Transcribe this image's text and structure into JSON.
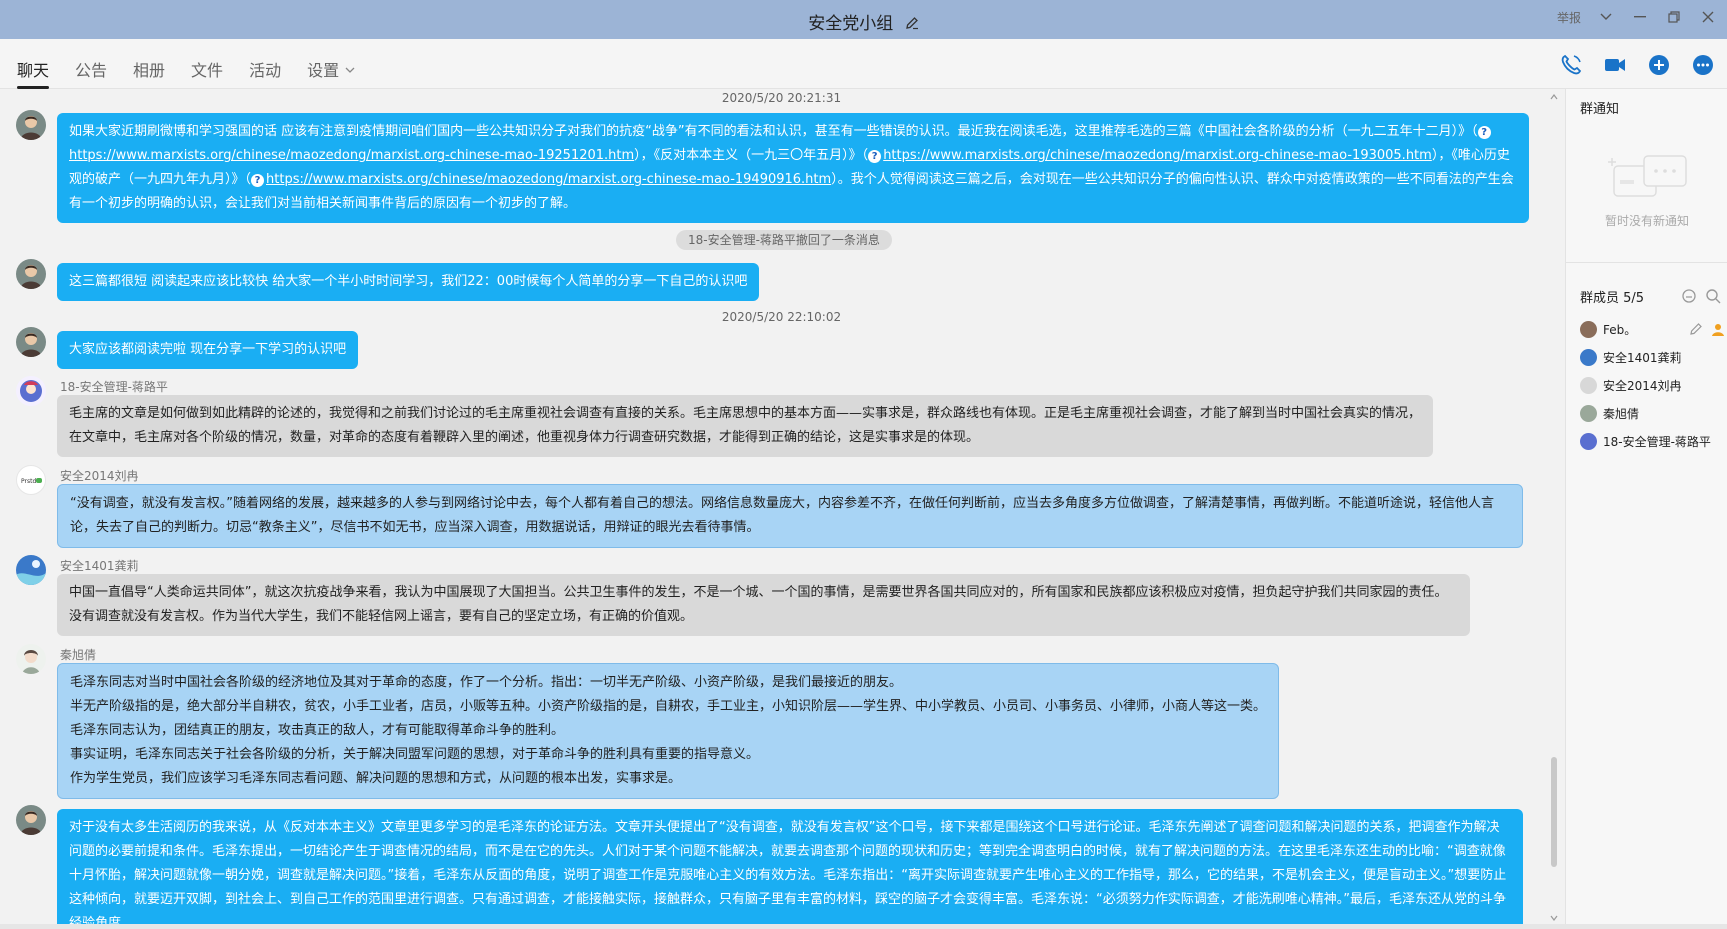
{
  "window": {
    "title": "安全党小组",
    "report_label": "举报"
  },
  "tabs": [
    {
      "label": "聊天",
      "active": true
    },
    {
      "label": "公告"
    },
    {
      "label": "相册"
    },
    {
      "label": "文件"
    },
    {
      "label": "活动"
    },
    {
      "label": "设置"
    }
  ],
  "chat": {
    "timestamp_1": "2020/5/20 20:21:31",
    "msg1": {
      "p1": "如果大家近期刷微博和学习强国的话 应该有注意到疫情期间咱们国内一些公共知识分子对我们的抗疫“战争”有不同的看法和认识，甚至有一些错误的认识。最近我在阅读毛选，这里推荐毛选的三篇《中国社会各阶级的分析（一九二五年十二月）》（",
      "link1": "https://www.marxists.org/chinese/maozedong/marxist.org-chinese-mao-19251201.htm",
      "p2": "），《反对本本主义（一九三〇年五月）》（",
      "link2": "https://www.marxists.org/chinese/maozedong/marxist.org-chinese-mao-193005.htm",
      "p3": "），《唯心历史观的破产（一九四九年九月）》（",
      "link3": "https://www.marxists.org/chinese/maozedong/marxist.org-chinese-mao-19490916.htm",
      "p4": "）。我个人觉得阅读这三篇之后，会对现在一些公共知识分子的偏向性认识、群众中对疫情政策的一些不同看法的产生会有一个初步的明确的认识，会让我们对当前相关新闻事件背后的原因有一个初步的了解。"
    },
    "recall_notice": "18-安全管理-蒋路平撤回了一条消息",
    "msg2": "这三篇都很短 阅读起来应该比较快 给大家一个半小时时间学习，我们22：00时候每个人简单的分享一下自己的认识吧",
    "timestamp_2": "2020/5/20 22:10:02",
    "msg3": "大家应该都阅读完啦 现在分享一下学习的认识吧",
    "msg4": {
      "sender": "18-安全管理-蒋路平",
      "text": "毛主席的文章是如何做到如此精辟的论述的，我觉得和之前我们讨论过的毛主席重视社会调查有直接的关系。毛主席思想中的基本方面——实事求是，群众路线也有体现。正是毛主席重视社会调查，才能了解到当时中国社会真实的情况，在文章中，毛主席对各个阶级的情况，数量，对革命的态度有着鞭辟入里的阐述，他重视身体力行调查研究数据，才能得到正确的结论，这是实事求是的体现。"
    },
    "msg5": {
      "sender": "安全2014刘冉",
      "text": "“没有调查，就没有发言权。”随着网络的发展，越来越多的人参与到网络讨论中去，每个人都有着自己的想法。网络信息数量庞大，内容参差不齐，在做任何判断前，应当去多角度多方位做调查，了解清楚事情，再做判断。不能道听途说，轻信他人言论，失去了自己的判断力。切忌“教条主义”，尽信书不如无书，应当深入调查，用数据说话，用辩证的眼光去看待事情。"
    },
    "msg6": {
      "sender": "安全1401龚莉",
      "text": "中国一直倡导“人类命运共同体”，就这次抗疫战争来看，我认为中国展现了大国担当。公共卫生事件的发生，不是一个城、一个国的事情，是需要世界各国共同应对的，所有国家和民族都应该积极应对疫情，担负起守护我们共同家园的责任。没有调查就没有发言权。作为当代大学生，我们不能轻信网上谣言，要有自己的坚定立场，有正确的价值观。"
    },
    "msg7": {
      "sender": "秦旭倩",
      "lines": [
        "毛泽东同志对当时中国社会各阶级的经济地位及其对于革命的态度，作了一个分析。指出：一切半无产阶级、小资产阶级，是我们最接近的朋友。",
        "半无产阶级指的是，绝大部分半自耕农，贫农，小手工业者，店员，小贩等五种。小资产阶级指的是，自耕农，手工业主，小知识阶层——学生界、中小学教员、小员司、小事务员、小律师，小商人等这一类。",
        "毛泽东同志认为，团结真正的朋友，攻击真正的敌人，才有可能取得革命斗争的胜利。",
        "事实证明，毛泽东同志关于社会各阶级的分析，关于解决同盟军问题的思想，对于革命斗争的胜利具有重要的指导意义。",
        "作为学生党员，我们应该学习毛泽东同志看问题、解决问题的思想和方式，从问题的根本出发，实事求是。"
      ]
    },
    "msg8": "对于没有太多生活阅历的我来说，从《反对本本主义》文章里更多学习的是毛泽东的论证方法。文章开头便提出了“没有调查，就没有发言权”这个口号，接下来都是围绕这个口号进行论证。毛泽东先阐述了调查问题和解决问题的关系，把调查作为解决问题的必要前提和条件。毛泽东提出，一切结论产生于调查情况的结局，而不是在它的先头。人们对于某个问题不能解决，就要去调查那个问题的现状和历史；等到完全调查明白的时候，就有了解决问题的方法。在这里毛泽东还生动的比喻：“调查就像十月怀胎，解决问题就像一朝分娩，调查就是解决问题。”接着，毛泽东从反面的角度，说明了调查工作是克服唯心主义的有效方法。毛泽东指出：“离开实际调查就要产生唯心主义的工作指导，那么，它的结果，不是机会主义，便是盲动主义。”想要防止这种倾向，就要迈开双脚，到社会上、到自己工作的范围里进行调查。只有通过调查，才能接触实际，接触群众，只有脑子里有丰富的材料，踩空的脑子才会变得丰富。毛泽东说：“必须努力作实际调查，才能洗刷唯心精神。”最后，毛泽东还从党的斗争经验角度，"
  },
  "right_panel": {
    "notice_title": "群通知",
    "notice_empty": "暂时没有新通知",
    "members_title": "群成员 5/5",
    "members": [
      {
        "name": "Feb。",
        "color": "#8a6d5a"
      },
      {
        "name": "安全1401龚莉",
        "color": "#3a79c9"
      },
      {
        "name": "安全2014刘冉",
        "color": "#d8d8d8"
      },
      {
        "name": "秦旭倩",
        "color": "#9aa89a"
      },
      {
        "name": "18-安全管理-蒋路平",
        "color": "#5a6fd0"
      }
    ]
  },
  "colors": {
    "titlebar": "#9cb4d6",
    "my_bubble": "#1aaef3",
    "other_bubble": "#d9d9d9",
    "light_blue_bubble": "#a8d4f5"
  }
}
